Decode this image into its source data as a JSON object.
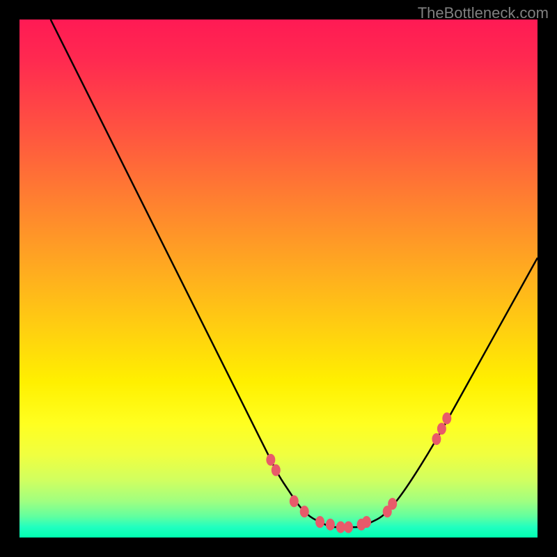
{
  "watermark": "TheBottleneck.com",
  "chart_data": {
    "type": "line",
    "title": "",
    "xlabel": "",
    "ylabel": "",
    "xlim": [
      0,
      100
    ],
    "ylim": [
      0,
      100
    ],
    "grid": false,
    "series": [
      {
        "name": "bottleneck-curve",
        "x": [
          6,
          10,
          15,
          20,
          25,
          30,
          35,
          40,
          45,
          48,
          50,
          52,
          54,
          56,
          58,
          60,
          62,
          64,
          66,
          68,
          70,
          72,
          75,
          80,
          85,
          90,
          95,
          100
        ],
        "y": [
          100,
          92,
          82,
          72,
          62,
          52,
          42,
          32,
          22,
          16,
          12,
          9,
          6,
          4,
          3,
          2,
          2,
          2,
          2,
          3,
          4,
          6,
          10,
          18,
          27,
          36,
          45,
          54
        ]
      }
    ],
    "highlight_points": {
      "name": "marked-dots",
      "x": [
        48.5,
        49.5,
        53,
        55,
        58,
        60,
        62,
        63.5,
        66,
        67,
        71,
        72,
        80.5,
        81.5,
        82.5
      ],
      "y": [
        15,
        13,
        7,
        5,
        3,
        2.5,
        2,
        2,
        2.5,
        3,
        5,
        6.5,
        19,
        21,
        23
      ]
    },
    "background": "heat-gradient",
    "gradient_stops": [
      {
        "pos": 0,
        "color": "#ff1a54"
      },
      {
        "pos": 50,
        "color": "#ffd010"
      },
      {
        "pos": 100,
        "color": "#00ffb0"
      }
    ]
  }
}
